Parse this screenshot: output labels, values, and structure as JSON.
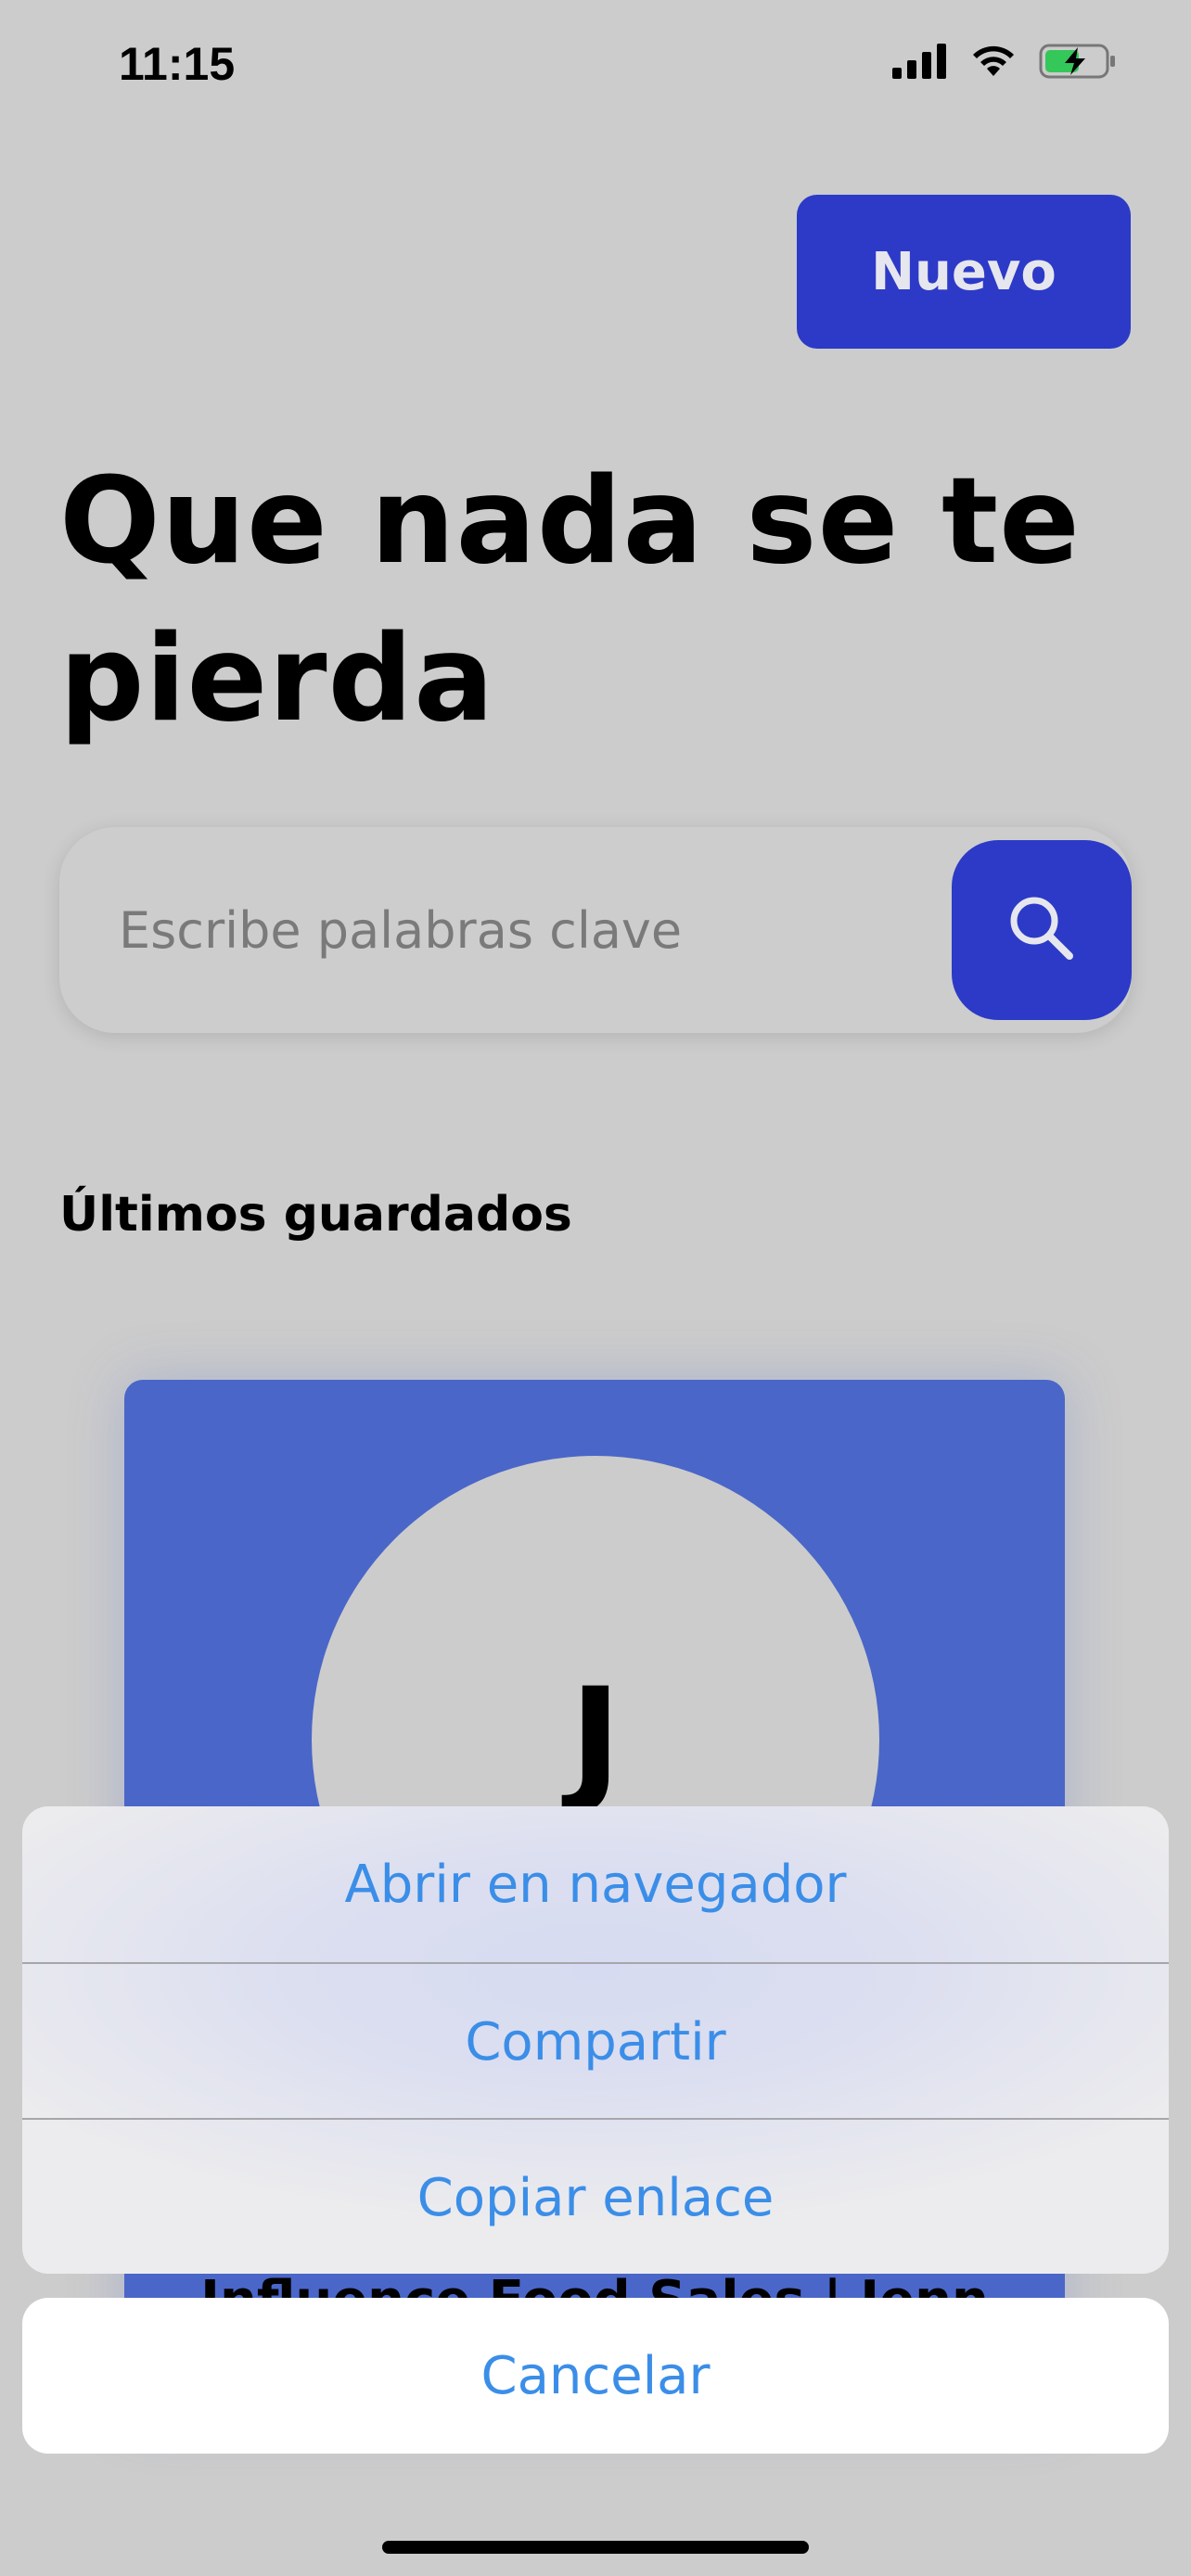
{
  "status_bar": {
    "time": "11:15",
    "signal_icon": "cellular-signal-icon",
    "wifi_icon": "wifi-icon",
    "battery_icon": "battery-charging-icon",
    "battery_color": "#34c759"
  },
  "header": {
    "new_button_label": "Nuevo"
  },
  "title_lines": [
    "Que nada se te",
    "pierda"
  ],
  "search": {
    "placeholder": "Escribe palabras clave",
    "button_icon": "search-icon"
  },
  "section": {
    "title": "Últimos guardados"
  },
  "card": {
    "avatar_letter": "J",
    "title": "Influence Food Sales | Jenn"
  },
  "action_sheet": {
    "items": [
      "Abrir en navegador",
      "Compartir",
      "Copiar enlace"
    ],
    "cancel_label": "Cancelar"
  },
  "colors": {
    "accent": "#2c3ac7",
    "card": "#4a66c8",
    "action_text": "#3b8ee8",
    "background": "#cccccc"
  }
}
